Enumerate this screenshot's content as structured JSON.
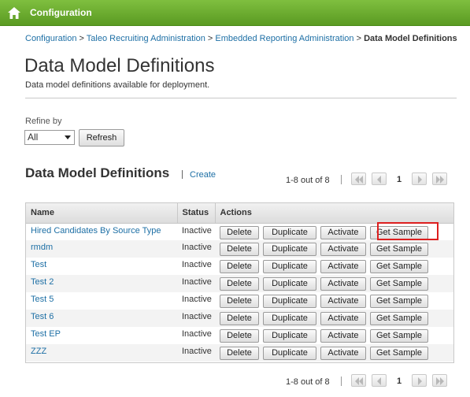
{
  "header": {
    "title": "Configuration",
    "icon": "home-icon"
  },
  "breadcrumb": {
    "items": [
      "Configuration",
      "Taleo Recruiting Administration",
      "Embedded Reporting Administration"
    ],
    "separator": ">",
    "current": "Data Model Definitions"
  },
  "page": {
    "title": "Data Model Definitions",
    "description": "Data model definitions available for deployment."
  },
  "filter": {
    "label": "Refine by",
    "value": "All",
    "refresh_label": "Refresh"
  },
  "section": {
    "title": "Data Model Definitions",
    "create_label": "Create"
  },
  "pager": {
    "count_text": "1-8 out of 8",
    "divider": "|",
    "page": "1"
  },
  "table": {
    "columns": [
      "Name",
      "Status",
      "Actions"
    ],
    "action_labels": [
      "Delete",
      "Duplicate",
      "Activate",
      "Get Sample"
    ],
    "rows": [
      {
        "name": "Hired Candidates By Source Type",
        "status": "Inactive"
      },
      {
        "name": "rmdm",
        "status": "Inactive"
      },
      {
        "name": "Test",
        "status": "Inactive"
      },
      {
        "name": "Test 2",
        "status": "Inactive"
      },
      {
        "name": "Test 5",
        "status": "Inactive"
      },
      {
        "name": "Test 6",
        "status": "Inactive"
      },
      {
        "name": "Test EP",
        "status": "Inactive"
      },
      {
        "name": "ZZZ",
        "status": "Inactive"
      }
    ]
  },
  "colors": {
    "header_green": "#6aaa2e",
    "link_blue": "#1d6fa5",
    "highlight_red": "#dd1f1f"
  }
}
